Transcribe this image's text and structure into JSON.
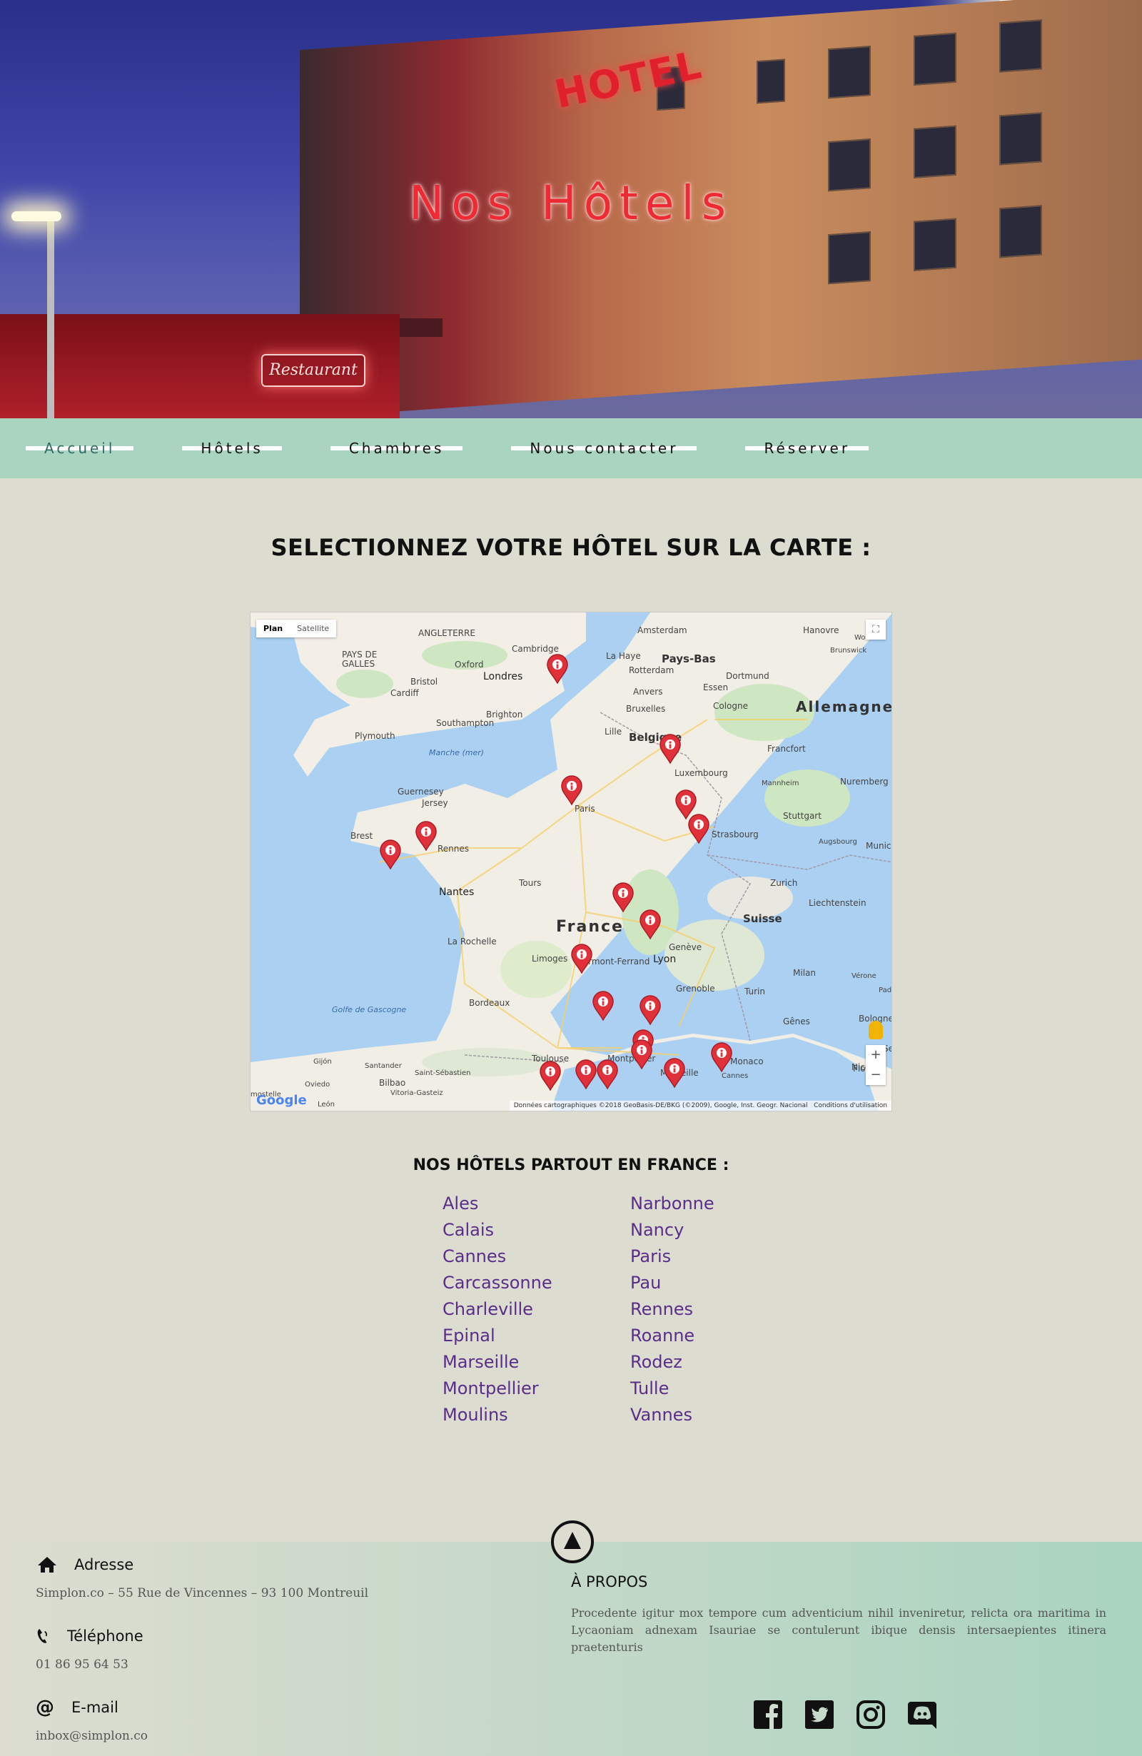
{
  "hero": {
    "title": "Nos Hôtels",
    "sign": "HOTEL",
    "restaurant_sign": "Restaurant"
  },
  "nav": {
    "items": [
      {
        "label": "Accueil",
        "active": true
      },
      {
        "label": "Hôtels"
      },
      {
        "label": "Chambres"
      },
      {
        "label": "Nous contacter"
      },
      {
        "label": "Réserver"
      }
    ]
  },
  "main": {
    "title": "SELECTIONNEZ VOTRE HÔTEL SUR LA CARTE :",
    "map": {
      "type_plan": "Plan",
      "type_satellite": "Satellite",
      "attribution": "Données cartographiques ©2018 GeoBasis-DE/BKG (©2009), Google, Inst. Geogr. Nacional",
      "terms": "Conditions d'utilisation",
      "logo": "Google",
      "labels": {
        "angleterre": "ANGLETERRE",
        "pays_galles_1": "PAYS DE",
        "pays_galles_2": "GALLES",
        "cambridge": "Cambridge",
        "oxford": "Oxford",
        "londres": "Londres",
        "bristol": "Bristol",
        "cardiff": "Cardiff",
        "southampton": "Southampton",
        "brighton": "Brighton",
        "plymouth": "Plymouth",
        "manche": "Manche (mer)",
        "guernesey": "Guernesey",
        "jersey": "Jersey",
        "brest": "Brest",
        "rennes": "Rennes",
        "nantes": "Nantes",
        "tours": "Tours",
        "la_rochelle": "La Rochelle",
        "limoges": "Limoges",
        "clermont": "Clermont-Ferrand",
        "bordeaux": "Bordeaux",
        "golfe": "Golfe de Gascogne",
        "toulouse": "Toulouse",
        "montpellier": "Montpellier",
        "marseille": "Marseille",
        "cannes": "Cannes",
        "monaco": "Monaco",
        "nice": "Nice",
        "france": "France",
        "paris": "Paris",
        "lyon": "Lyon",
        "geneve": "Genève",
        "grenoble": "Grenoble",
        "turin": "Turin",
        "milan": "Milan",
        "genes": "Gênes",
        "verone": "Vérone",
        "pad": "Pad",
        "bologne": "Bologne",
        "flo": "Flo",
        "se": "Se",
        "suisse": "Suisse",
        "zurich": "Zurich",
        "liechtenstein": "Liechtenstein",
        "strasbourg": "Strasbourg",
        "stuttgart": "Stuttgart",
        "augsbourg": "Augsbourg",
        "munich": "Munic",
        "nuremberg": "Nuremberg",
        "mannheim": "Mannheim",
        "francfort": "Francfort",
        "allemagne": "Allemagne",
        "cologne": "Cologne",
        "dortmund": "Dortmund",
        "essen": "Essen",
        "hanovre": "Hanovre",
        "wolfsburg": "Wolfsbu",
        "brunswick": "Brunswick",
        "amsterdam": "Amsterdam",
        "la_haye": "La Haye",
        "pays_bas": "Pays-Bas",
        "rotterdam": "Rotterdam",
        "anvers": "Anvers",
        "bruxelles": "Bruxelles",
        "lille": "Lille",
        "belgique": "Belgique",
        "luxembourg": "Luxembourg",
        "gijon": "Gijón",
        "oviedo": "Oviedo",
        "santander": "Santander",
        "bilbao": "Bilbao",
        "saint_sebastien": "Saint-Sébastien",
        "vitoria": "Vitoria-Gasteiz",
        "leon": "León",
        "mostelle": "mostelle"
      }
    },
    "list_title": "NOS HÔTELS PARTOUT EN FRANCE :",
    "hotels": [
      "Ales",
      "Narbonne",
      "Calais",
      "Nancy",
      "Cannes",
      "Paris",
      "Carcassonne",
      "Pau",
      "Charleville",
      "Rennes",
      "Epinal",
      "Roanne",
      "Marseille",
      "Rodez",
      "Montpellier",
      "Tulle",
      "Moulins",
      "Vannes"
    ]
  },
  "footer": {
    "address_label": "Adresse",
    "address": "Simplon.co – 55 Rue de Vincennes – 93 100 Montreuil",
    "phone_label": "Téléphone",
    "phone": "01 86 95 64 53",
    "email_label": "E-mail",
    "email": "inbox@simplon.co",
    "about_title": "À PROPOS",
    "about_text": "Procedente igitur mox tempore cum adventicium nihil inveniretur, relicta ora maritima in Lycaoniam adnexam Isauriae se contulerunt ibique densis intersaepientes itinera praetenturis",
    "socials": [
      "facebook-icon",
      "twitter-icon",
      "instagram-icon",
      "discord-icon"
    ]
  },
  "colors": {
    "nav_bg": "#a9d4c0",
    "page_bg": "#dcddd0",
    "link": "#5a2d8a",
    "hero_title": "#ee2a34",
    "pin": "#e0313b"
  }
}
